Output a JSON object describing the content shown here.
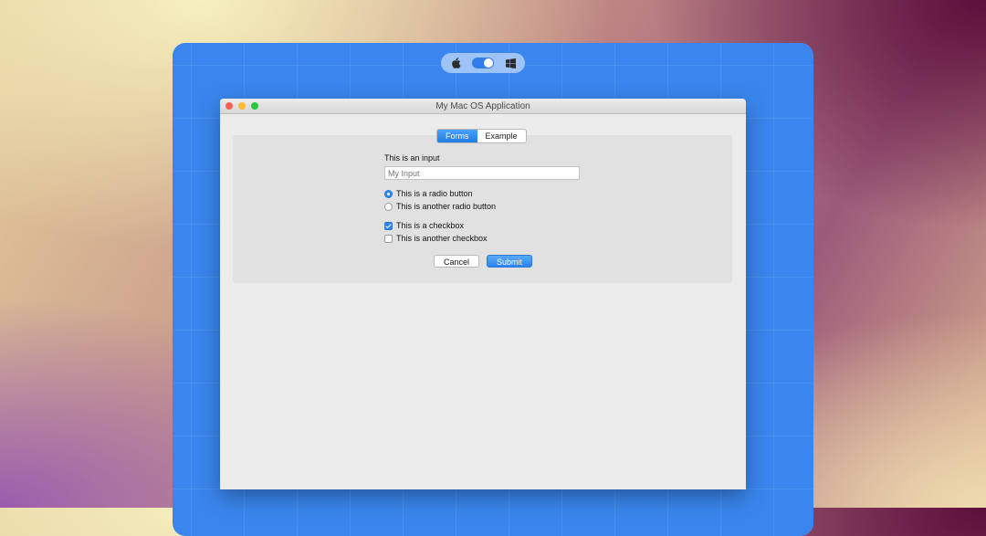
{
  "os_switcher": {
    "left_icon": "apple-icon",
    "right_icon": "windows-icon",
    "toggle_state": "on"
  },
  "window": {
    "title": "My Mac OS Application",
    "controls": [
      "close",
      "minimize",
      "zoom"
    ]
  },
  "tabs": [
    {
      "label": "Forms",
      "active": true
    },
    {
      "label": "Example",
      "active": false
    }
  ],
  "form": {
    "input_label": "This is an input",
    "input_placeholder": "My Input",
    "input_value": "",
    "radios": [
      {
        "label": "This is a radio button",
        "checked": true
      },
      {
        "label": "This is another radio button",
        "checked": false
      }
    ],
    "checkboxes": [
      {
        "label": "This is a checkbox",
        "checked": true
      },
      {
        "label": "This is another checkbox",
        "checked": false
      }
    ],
    "cancel_label": "Cancel",
    "submit_label": "Submit"
  },
  "colors": {
    "stage_blue": "#3a86ee",
    "accent": "#2f86f0"
  }
}
